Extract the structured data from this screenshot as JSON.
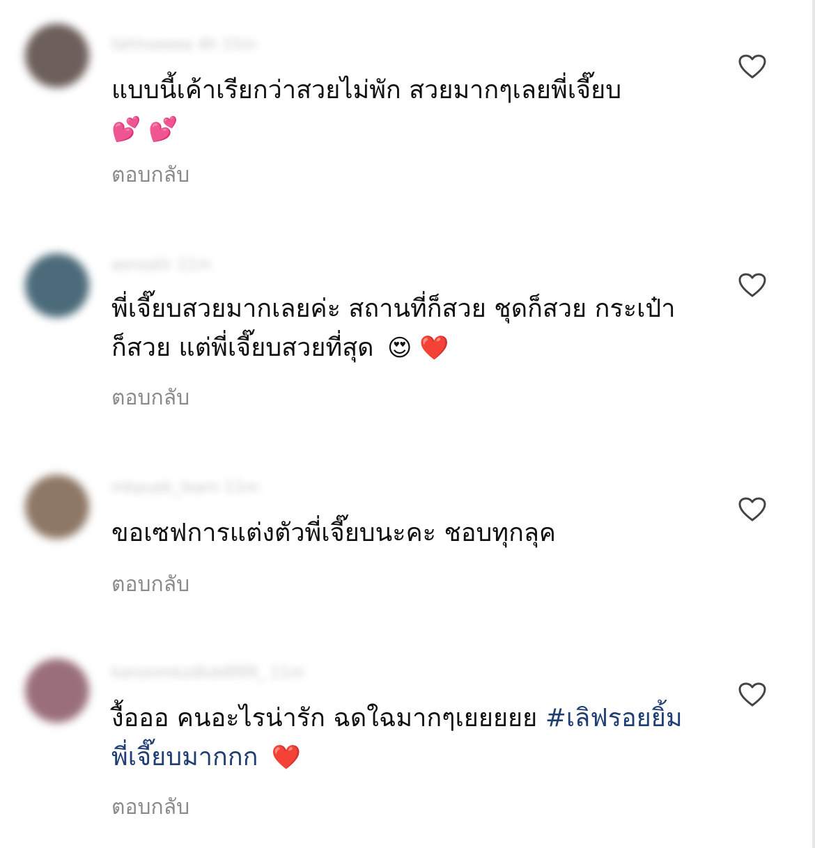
{
  "comments": [
    {
      "username": "fahhoeeee 4h 15m",
      "text": "แบบนี้เค้าเรียกว่าสวยไม่พัก สวยมากๆเลยพี่เจี๊ยบ",
      "emojis": "💕 💕",
      "reply_label": "ตอบกลับ",
      "avatar_color": "#6d5f5b"
    },
    {
      "username": "aonsalir 11m",
      "text": "พี่เจี๊ยบสวยมากเลยค่ะ สถานที่ก็สวย ชุดก็สวย กระเป๋าก็สวย แต่พี่เจี๊ยบสวยที่สุด",
      "emojis": "😍 ❤️",
      "reply_label": "ตอบกลับ",
      "avatar_color": "#4c6b7a"
    },
    {
      "username": "mkpuek_learn 11m",
      "text": "ขอเซฟการแต่งตัวพี่เจี๊ยบนะคะ ชอบทุกลุค",
      "emojis": "",
      "reply_label": "ตอบกลับ",
      "avatar_color": "#8d7766"
    },
    {
      "username": "kanonmkzdkdd999_ 11m",
      "text": "งื้อออ คนอะไรน่ารัก ฉดใฉมากๆเยยยยย",
      "hashtag": "#เลิฟรอยยิ้มพี่เจี๊ยบมากกก",
      "emojis": "❤️",
      "reply_label": "ตอบกลับ",
      "avatar_color": "#9a6f79"
    }
  ],
  "icons": {
    "like": "heart-outline-icon"
  },
  "colors": {
    "text": "#111111",
    "reply": "#8a8a8a",
    "hashtag": "#1f3e73",
    "like_icon": "#444444"
  }
}
